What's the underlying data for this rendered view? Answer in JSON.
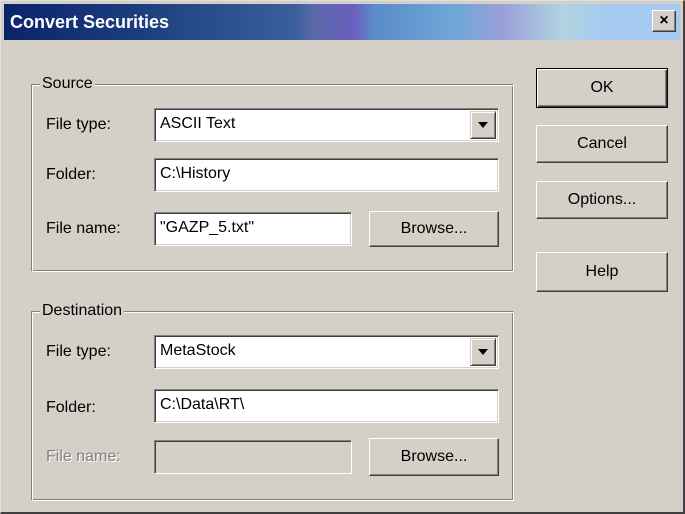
{
  "window": {
    "title": "Convert Securities",
    "close_glyph": "×",
    "close_icon": "close-icon"
  },
  "source": {
    "group_label": "Source",
    "file_type_label": "File type:",
    "file_type_value": "ASCII Text",
    "folder_label": "Folder:",
    "folder_value": "C:\\History",
    "file_name_label": "File name:",
    "file_name_value": "\"GAZP_5.txt\"",
    "browse_label": "Browse..."
  },
  "destination": {
    "group_label": "Destination",
    "file_type_label": "File type:",
    "file_type_value": "MetaStock",
    "folder_label": "Folder:",
    "folder_value": "C:\\Data\\RT\\",
    "file_name_label": "File name:",
    "file_name_value": "",
    "browse_label": "Browse..."
  },
  "buttons": {
    "ok": "OK",
    "cancel": "Cancel",
    "options": "Options...",
    "help": "Help"
  },
  "colors": {
    "face": "#d4d0c8",
    "title_start": "#0a246a",
    "title_end": "#a6caf0"
  }
}
